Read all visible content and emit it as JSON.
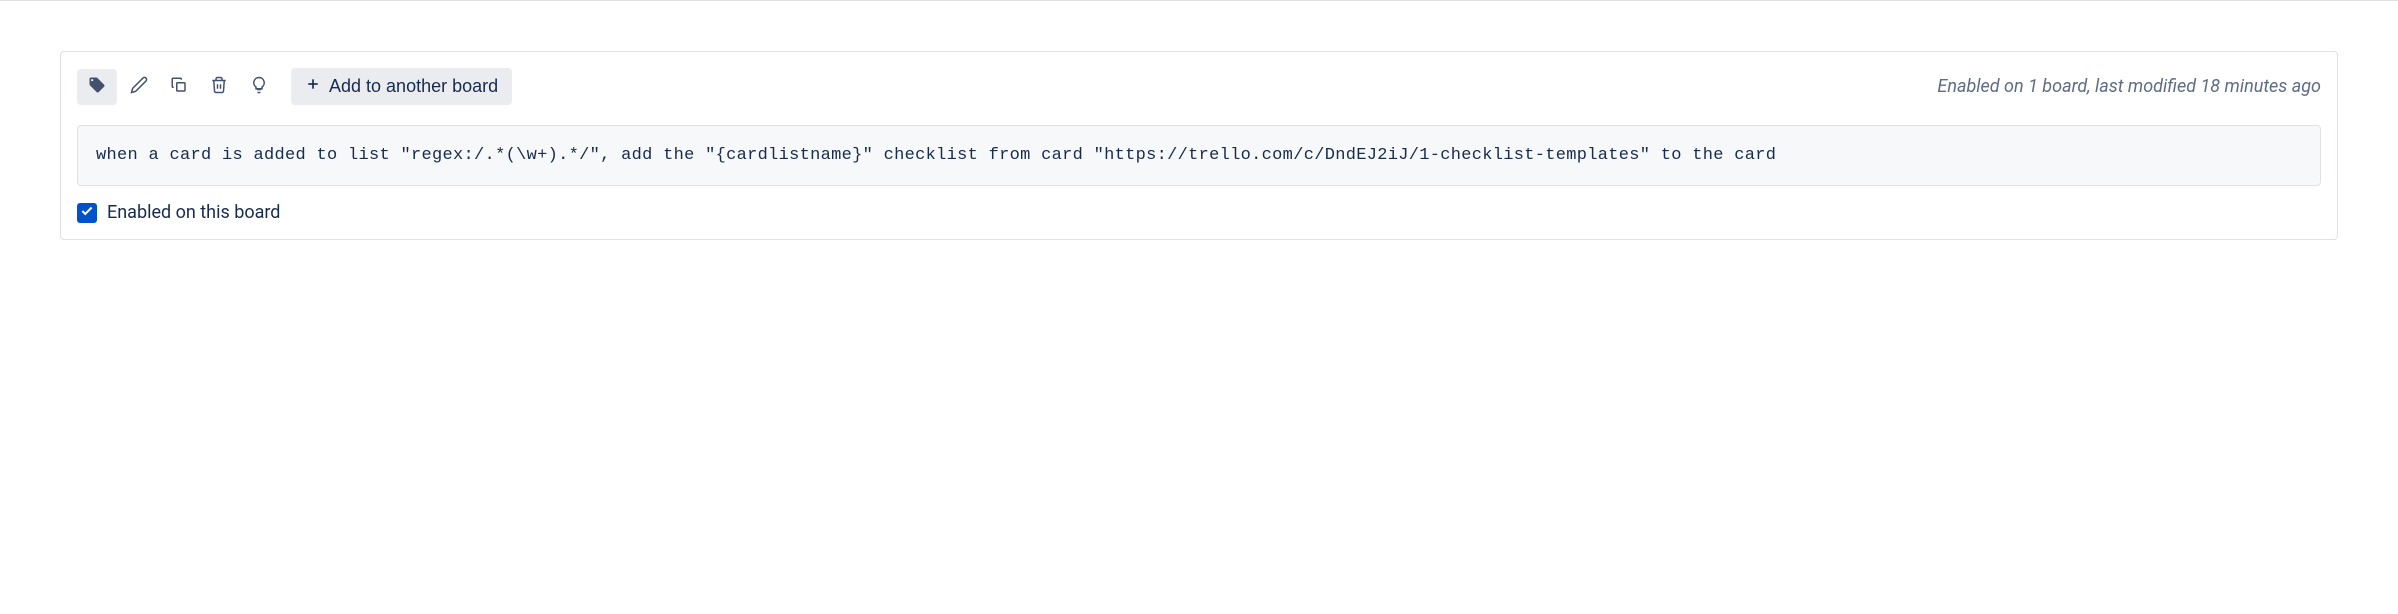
{
  "rule": {
    "status_text": "Enabled on 1 board, last modified 18 minutes ago",
    "add_board_label": "Add to another board",
    "rule_text": "when a card is added to list \"regex:/.*(\\w+).*/\", add the \"{cardlistname}\" checklist from card \"https://trello.com/c/DndEJ2iJ/1-checklist-templates\" to the card",
    "enabled_label": "Enabled on this board",
    "enabled_checked": true
  }
}
